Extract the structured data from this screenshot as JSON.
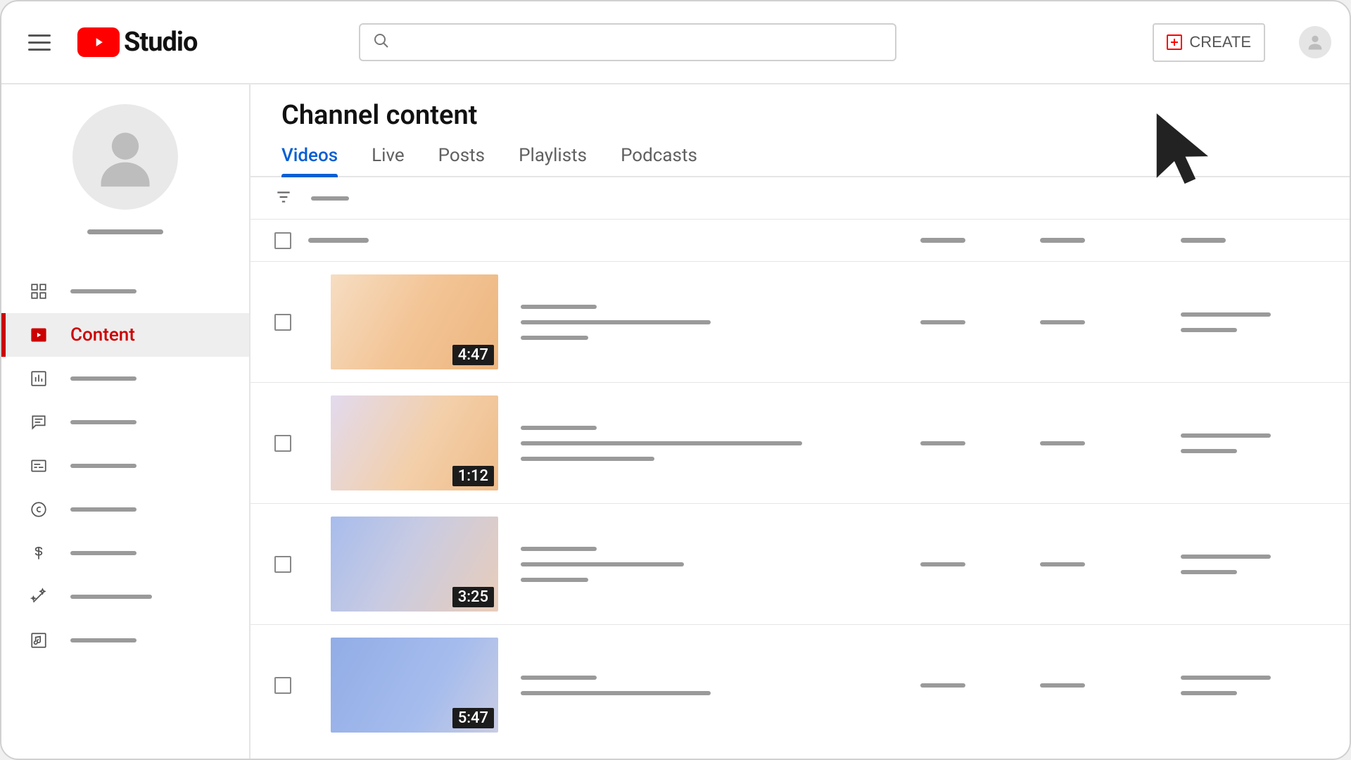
{
  "header": {
    "logo_text": "Studio",
    "search_placeholder": "",
    "create_label": "CREATE"
  },
  "sidebar": {
    "items": [
      {
        "id": "dashboard",
        "label": ""
      },
      {
        "id": "content",
        "label": "Content"
      },
      {
        "id": "analytics",
        "label": ""
      },
      {
        "id": "comments",
        "label": ""
      },
      {
        "id": "subtitles",
        "label": ""
      },
      {
        "id": "copyright",
        "label": ""
      },
      {
        "id": "earn",
        "label": ""
      },
      {
        "id": "customize",
        "label": ""
      },
      {
        "id": "audio",
        "label": ""
      }
    ],
    "active_index": 1
  },
  "main": {
    "title": "Channel content",
    "tabs": [
      {
        "label": "Videos"
      },
      {
        "label": "Live"
      },
      {
        "label": "Posts"
      },
      {
        "label": "Playlists"
      },
      {
        "label": "Podcasts"
      }
    ],
    "active_tab": 0,
    "videos": [
      {
        "duration": "4:47",
        "thumb_class": "grad1"
      },
      {
        "duration": "1:12",
        "thumb_class": "grad2"
      },
      {
        "duration": "3:25",
        "thumb_class": "grad3"
      },
      {
        "duration": "5:47",
        "thumb_class": "grad4"
      }
    ]
  }
}
